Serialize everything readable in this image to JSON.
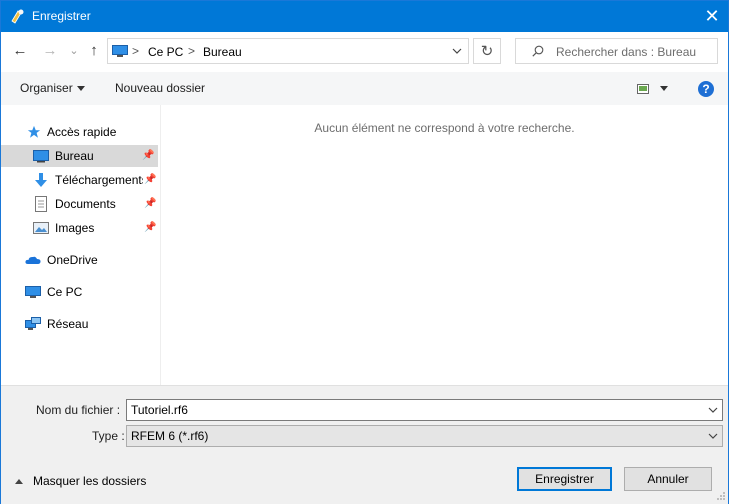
{
  "window": {
    "title": "Enregistrer",
    "close_glyph": "✕"
  },
  "nav": {
    "back_glyph": "←",
    "forward_glyph": "→",
    "recent_glyph": "⌄",
    "up_glyph": "↑",
    "breadcrumb": [
      "Ce PC",
      "Bureau"
    ],
    "separator": ">",
    "refresh_glyph": "↻",
    "search_placeholder": "Rechercher dans : Bureau"
  },
  "toolbar": {
    "organize_label": "Organiser",
    "new_folder_label": "Nouveau dossier",
    "help_glyph": "?"
  },
  "sidebar": {
    "quick_access": "Accès rapide",
    "items": [
      {
        "label": "Bureau",
        "icon": "desktop-icon",
        "pinned": true,
        "selected": true
      },
      {
        "label": "Téléchargements",
        "icon": "download-icon",
        "pinned": true
      },
      {
        "label": "Documents",
        "icon": "documents-icon",
        "pinned": true
      },
      {
        "label": "Images",
        "icon": "images-icon",
        "pinned": true
      }
    ],
    "onedrive": "OneDrive",
    "this_pc": "Ce PC",
    "network": "Réseau"
  },
  "content": {
    "empty_message": "Aucun élément ne correspond à votre recherche."
  },
  "form": {
    "filename_label": "Nom du fichier :",
    "filename_value": "Tutoriel.rf6",
    "type_label": "Type :",
    "type_value": "RFEM 6 (*.rf6)"
  },
  "footer": {
    "hide_folders_label": "Masquer les dossiers",
    "save_label": "Enregistrer",
    "cancel_label": "Annuler"
  },
  "colors": {
    "accent": "#0078d7",
    "selected_bg": "#d9d9d9"
  }
}
